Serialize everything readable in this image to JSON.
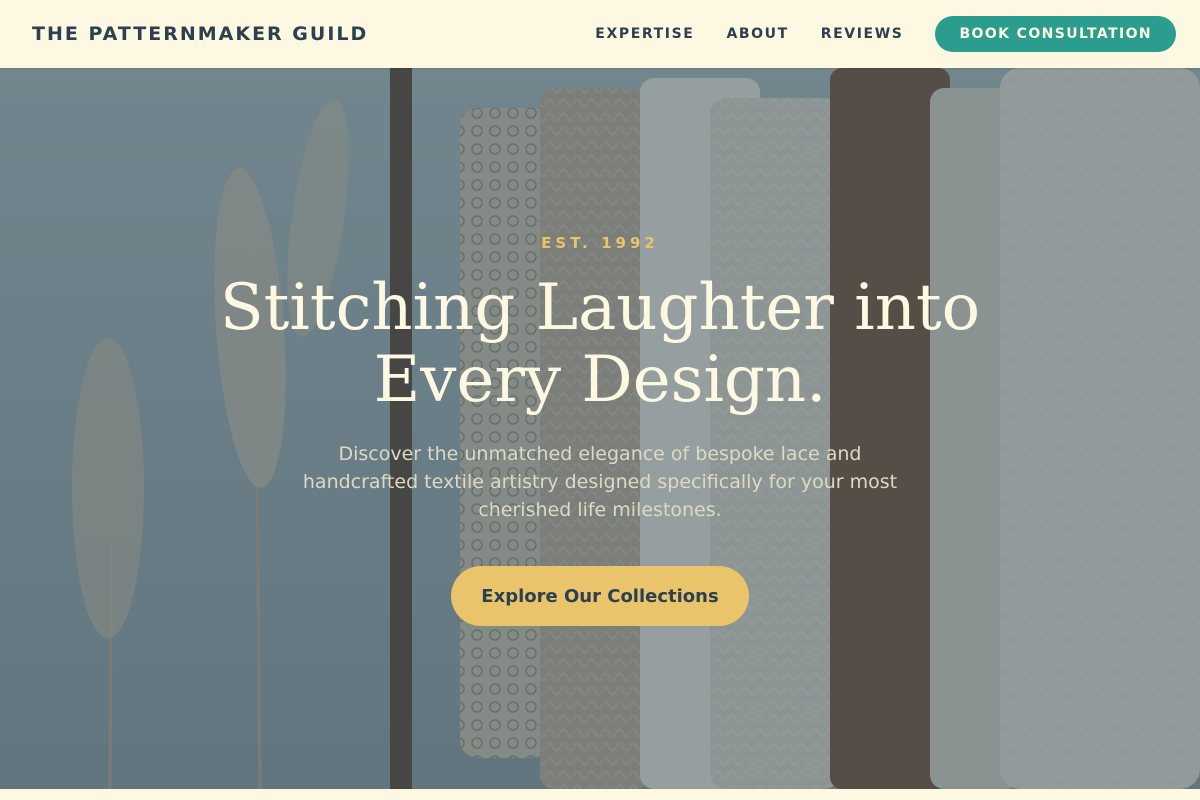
{
  "header": {
    "brand": "THE PATTERNMAKER GUILD",
    "nav": [
      "EXPERTISE",
      "ABOUT",
      "REVIEWS"
    ],
    "cta": "BOOK CONSULTATION"
  },
  "hero": {
    "eyebrow": "EST. 1992",
    "title": "Stitching Laughter into Every Design.",
    "subtitle": "Discover the unmatched elegance of bespoke lace and handcrafted textile artistry designed specifically for your most cherished life milestones.",
    "button": "Explore Our Collections"
  },
  "colors": {
    "background": "#fdf8e1",
    "brand_text": "#2b4151",
    "accent_teal": "#2a9d8f",
    "accent_gold": "#e9c46a",
    "overlay": "#26404e"
  }
}
